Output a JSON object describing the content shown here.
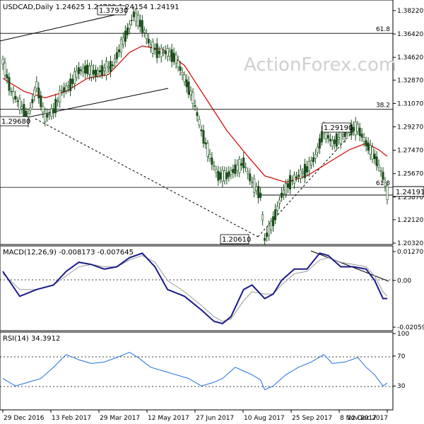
{
  "chart_data": [
    {
      "type": "candlestick",
      "symbol": "USDCAD",
      "interval": "Daily",
      "ohlc_text": "1.24625 1.24709 1.24154 1.24191",
      "watermark": "ActionForex.com",
      "y_ticks": [
        "1.38220",
        "1.36420",
        "1.34620",
        "1.32870",
        "1.31070",
        "1.29270",
        "1.27470",
        "1.25670",
        "1.23870",
        "1.22120",
        "1.20320"
      ],
      "ylim": [
        1.2032,
        1.3822
      ],
      "x_ticks": [
        "29 Dec 2016",
        "13 Feb 2017",
        "29 Mar 2017",
        "12 May 2017",
        "27 Jun 2017",
        "10 Aug 2017",
        "25 Sep 2017",
        "8 Nov 2017",
        "22 Dec 2017"
      ],
      "fib_levels": [
        {
          "label": "61.8",
          "value": 1.3647
        },
        {
          "label": "38.2",
          "value": 1.3062
        },
        {
          "label": "61.8",
          "value": 1.2461
        }
      ],
      "price_labels": [
        {
          "text": "1.37930",
          "value": 1.3793
        },
        {
          "text": "1.29680",
          "value": 1.2968
        },
        {
          "text": "1.20610",
          "value": 1.2061
        },
        {
          "text": "1.29190",
          "value": 1.2919
        }
      ],
      "last_price": "1.24191",
      "price_path": [
        [
          0,
          1.343
        ],
        [
          4,
          1.32
        ],
        [
          8,
          1.31
        ],
        [
          12,
          1.3
        ],
        [
          16,
          1.325
        ],
        [
          20,
          1.3
        ],
        [
          24,
          1.305
        ],
        [
          28,
          1.32
        ],
        [
          32,
          1.325
        ],
        [
          36,
          1.336
        ],
        [
          40,
          1.337
        ],
        [
          44,
          1.334
        ],
        [
          48,
          1.337
        ],
        [
          52,
          1.34
        ],
        [
          56,
          1.355
        ],
        [
          60,
          1.37
        ],
        [
          62,
          1.3793
        ],
        [
          66,
          1.37
        ],
        [
          70,
          1.355
        ],
        [
          74,
          1.35
        ],
        [
          78,
          1.35
        ],
        [
          82,
          1.345
        ],
        [
          86,
          1.33
        ],
        [
          90,
          1.315
        ],
        [
          94,
          1.29
        ],
        [
          98,
          1.27
        ],
        [
          102,
          1.255
        ],
        [
          106,
          1.255
        ],
        [
          110,
          1.26
        ],
        [
          114,
          1.265
        ],
        [
          118,
          1.25
        ],
        [
          122,
          1.24
        ],
        [
          124,
          1.2061
        ],
        [
          128,
          1.22
        ],
        [
          132,
          1.24
        ],
        [
          136,
          1.25
        ],
        [
          140,
          1.255
        ],
        [
          144,
          1.26
        ],
        [
          148,
          1.27
        ],
        [
          152,
          1.29
        ],
        [
          156,
          1.28
        ],
        [
          160,
          1.285
        ],
        [
          164,
          1.29
        ],
        [
          168,
          1.2919
        ],
        [
          172,
          1.28
        ],
        [
          176,
          1.27
        ],
        [
          180,
          1.255
        ],
        [
          182,
          1.2419
        ]
      ],
      "ma_path": [
        [
          0,
          1.33
        ],
        [
          10,
          1.32
        ],
        [
          20,
          1.315
        ],
        [
          30,
          1.32
        ],
        [
          40,
          1.33
        ],
        [
          50,
          1.333
        ],
        [
          60,
          1.35
        ],
        [
          66,
          1.355
        ],
        [
          76,
          1.352
        ],
        [
          86,
          1.34
        ],
        [
          96,
          1.315
        ],
        [
          106,
          1.29
        ],
        [
          116,
          1.27
        ],
        [
          124,
          1.255
        ],
        [
          134,
          1.25
        ],
        [
          144,
          1.255
        ],
        [
          154,
          1.265
        ],
        [
          164,
          1.275
        ],
        [
          172,
          1.28
        ],
        [
          178,
          1.275
        ],
        [
          182,
          1.27
        ]
      ]
    },
    {
      "type": "line",
      "title": "MACD(12,26,9) -0.008173 -0.007645",
      "y_ticks": [
        "0.012707",
        "0.00",
        "-0.020595"
      ],
      "ylim": [
        -0.020595,
        0.012707
      ],
      "series": [
        {
          "values": [
            [
              0,
              0.004
            ],
            [
              8,
              -0.007
            ],
            [
              16,
              -0.004
            ],
            [
              24,
              -0.002
            ],
            [
              30,
              0.004
            ],
            [
              36,
              0.008
            ],
            [
              42,
              0.007
            ],
            [
              48,
              0.005
            ],
            [
              54,
              0.006
            ],
            [
              60,
              0.01
            ],
            [
              66,
              0.012
            ],
            [
              72,
              0.006
            ],
            [
              78,
              -0.004
            ],
            [
              86,
              -0.007
            ],
            [
              94,
              -0.013
            ],
            [
              100,
              -0.018
            ],
            [
              104,
              -0.019
            ],
            [
              108,
              -0.016
            ],
            [
              114,
              -0.004
            ],
            [
              118,
              -0.002
            ],
            [
              124,
              -0.008
            ],
            [
              128,
              -0.006
            ],
            [
              132,
              0.0
            ],
            [
              138,
              0.005
            ],
            [
              144,
              0.005
            ],
            [
              150,
              0.012
            ],
            [
              154,
              0.011
            ],
            [
              160,
              0.006
            ],
            [
              166,
              0.006
            ],
            [
              172,
              0.005
            ],
            [
              176,
              0.0
            ],
            [
              180,
              -0.008
            ],
            [
              182,
              -0.008
            ]
          ]
        },
        {
          "values": [
            [
              0,
              0.003
            ],
            [
              8,
              -0.004
            ],
            [
              16,
              -0.004
            ],
            [
              24,
              -0.002
            ],
            [
              30,
              0.002
            ],
            [
              36,
              0.006
            ],
            [
              42,
              0.007
            ],
            [
              48,
              0.006
            ],
            [
              54,
              0.006
            ],
            [
              60,
              0.009
            ],
            [
              66,
              0.011
            ],
            [
              72,
              0.008
            ],
            [
              78,
              0.0
            ],
            [
              86,
              -0.005
            ],
            [
              94,
              -0.011
            ],
            [
              100,
              -0.016
            ],
            [
              104,
              -0.018
            ],
            [
              108,
              -0.017
            ],
            [
              114,
              -0.009
            ],
            [
              118,
              -0.005
            ],
            [
              124,
              -0.006
            ],
            [
              128,
              -0.006
            ],
            [
              132,
              -0.002
            ],
            [
              138,
              0.003
            ],
            [
              144,
              0.004
            ],
            [
              150,
              0.009
            ],
            [
              154,
              0.01
            ],
            [
              160,
              0.008
            ],
            [
              166,
              0.007
            ],
            [
              172,
              0.006
            ],
            [
              176,
              0.002
            ],
            [
              180,
              -0.005
            ],
            [
              182,
              -0.007
            ]
          ]
        }
      ]
    },
    {
      "type": "line",
      "title": "RSI(14) 34.3912",
      "y_ticks": [
        "100",
        "70",
        "30"
      ],
      "ylim": [
        0,
        100
      ],
      "series": [
        {
          "values": [
            [
              0,
              40
            ],
            [
              6,
              30
            ],
            [
              12,
              35
            ],
            [
              18,
              40
            ],
            [
              24,
              55
            ],
            [
              30,
              72
            ],
            [
              36,
              65
            ],
            [
              42,
              60
            ],
            [
              48,
              62
            ],
            [
              54,
              68
            ],
            [
              60,
              75
            ],
            [
              64,
              68
            ],
            [
              70,
              55
            ],
            [
              76,
              50
            ],
            [
              82,
              45
            ],
            [
              88,
              40
            ],
            [
              94,
              30
            ],
            [
              100,
              35
            ],
            [
              104,
              40
            ],
            [
              110,
              55
            ],
            [
              114,
              50
            ],
            [
              118,
              45
            ],
            [
              122,
              38
            ],
            [
              124,
              25
            ],
            [
              128,
              30
            ],
            [
              134,
              45
            ],
            [
              140,
              55
            ],
            [
              146,
              62
            ],
            [
              152,
              72
            ],
            [
              156,
              60
            ],
            [
              162,
              62
            ],
            [
              168,
              68
            ],
            [
              172,
              55
            ],
            [
              176,
              45
            ],
            [
              180,
              30
            ],
            [
              182,
              34
            ]
          ]
        }
      ]
    }
  ]
}
